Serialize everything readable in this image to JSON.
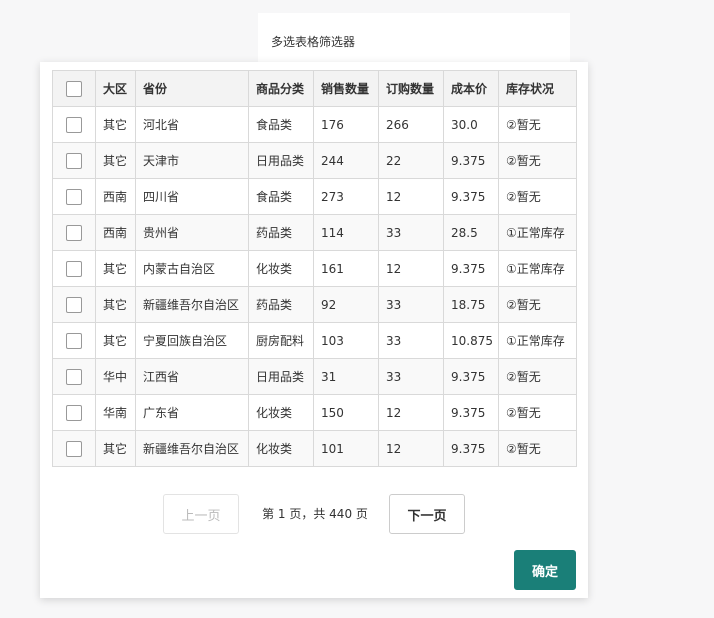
{
  "header": {
    "title": "多选表格筛选器"
  },
  "table": {
    "columns": [
      "大区",
      "省份",
      "商品分类",
      "销售数量",
      "订购数量",
      "成本价",
      "库存状况"
    ],
    "rows": [
      [
        "其它",
        "河北省",
        "食品类",
        "176",
        "266",
        "30.0",
        "②暂无"
      ],
      [
        "其它",
        "天津市",
        "日用品类",
        "244",
        "22",
        "9.375",
        "②暂无"
      ],
      [
        "西南",
        "四川省",
        "食品类",
        "273",
        "12",
        "9.375",
        "②暂无"
      ],
      [
        "西南",
        "贵州省",
        "药品类",
        "114",
        "33",
        "28.5",
        "①正常库存"
      ],
      [
        "其它",
        "内蒙古自治区",
        "化妆类",
        "161",
        "12",
        "9.375",
        "①正常库存"
      ],
      [
        "其它",
        "新疆维吾尔自治区",
        "药品类",
        "92",
        "33",
        "18.75",
        "②暂无"
      ],
      [
        "其它",
        "宁夏回族自治区",
        "厨房配料",
        "103",
        "33",
        "10.875",
        "①正常库存"
      ],
      [
        "华中",
        "江西省",
        "日用品类",
        "31",
        "33",
        "9.375",
        "②暂无"
      ],
      [
        "华南",
        "广东省",
        "化妆类",
        "150",
        "12",
        "9.375",
        "②暂无"
      ],
      [
        "其它",
        "新疆维吾尔自治区",
        "化妆类",
        "101",
        "12",
        "9.375",
        "②暂无"
      ]
    ]
  },
  "pager": {
    "prev_label": "上一页",
    "info": "第 1 页，共 440 页",
    "next_label": "下一页"
  },
  "confirm_label": "确定",
  "colors": {
    "accent": "#1a7f78"
  }
}
